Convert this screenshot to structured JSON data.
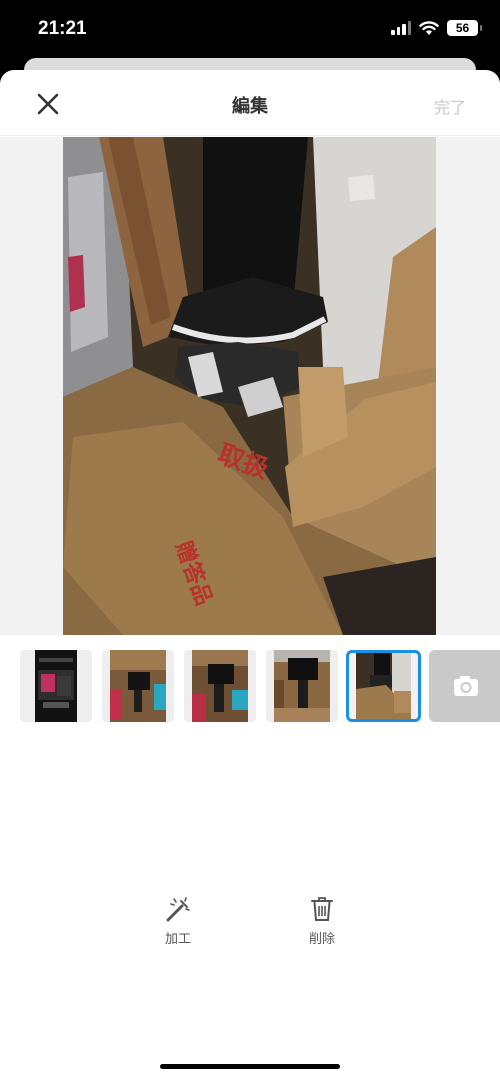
{
  "status_bar": {
    "time": "21:21",
    "battery_level": "56"
  },
  "header": {
    "title": "編集",
    "done_label": "完了"
  },
  "photo": {
    "red_text_1": "取扱",
    "red_text_2": "贈答品"
  },
  "thumbnails": [
    {
      "name": "thumb-1"
    },
    {
      "name": "thumb-2"
    },
    {
      "name": "thumb-3"
    },
    {
      "name": "thumb-4"
    },
    {
      "name": "thumb-5",
      "selected": true
    }
  ],
  "toolbar": {
    "edit_label": "加工",
    "delete_label": "削除"
  },
  "colors": {
    "accent": "#1a8fe3",
    "done_disabled": "#c8c8c8"
  }
}
